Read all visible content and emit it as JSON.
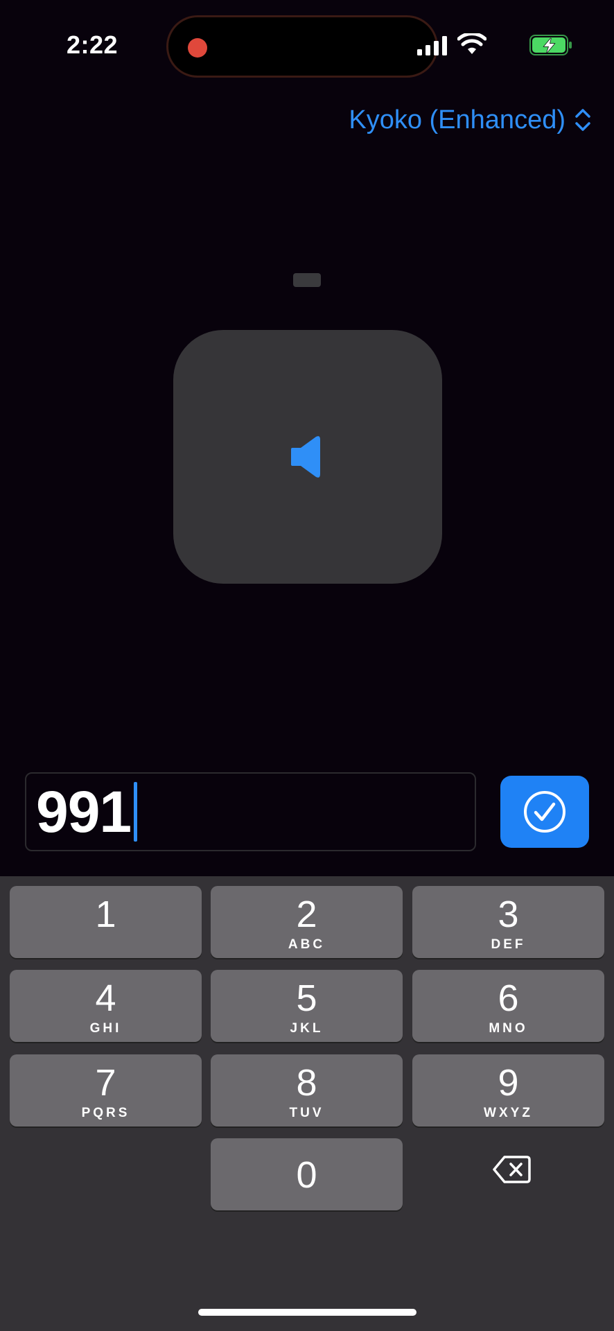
{
  "status_bar": {
    "time": "2:22",
    "recording": true,
    "battery_charging": true
  },
  "voice_picker": {
    "label": "Kyoko (Enhanced)"
  },
  "input": {
    "value": "991"
  },
  "confirm_button": {
    "icon": "checkmark-circle-icon"
  },
  "keypad": {
    "keys": [
      {
        "digit": "1",
        "letters": ""
      },
      {
        "digit": "2",
        "letters": "ABC"
      },
      {
        "digit": "3",
        "letters": "DEF"
      },
      {
        "digit": "4",
        "letters": "GHI"
      },
      {
        "digit": "5",
        "letters": "JKL"
      },
      {
        "digit": "6",
        "letters": "MNO"
      },
      {
        "digit": "7",
        "letters": "PQRS"
      },
      {
        "digit": "8",
        "letters": "TUV"
      },
      {
        "digit": "9",
        "letters": "WXYZ"
      },
      {
        "digit": "0",
        "letters": ""
      }
    ],
    "delete_icon": "backspace-icon"
  },
  "colors": {
    "accent": "#1f82f5",
    "background": "#08020c",
    "key": "#6b696d",
    "keypad_bg": "#343236",
    "card": "#363538"
  }
}
